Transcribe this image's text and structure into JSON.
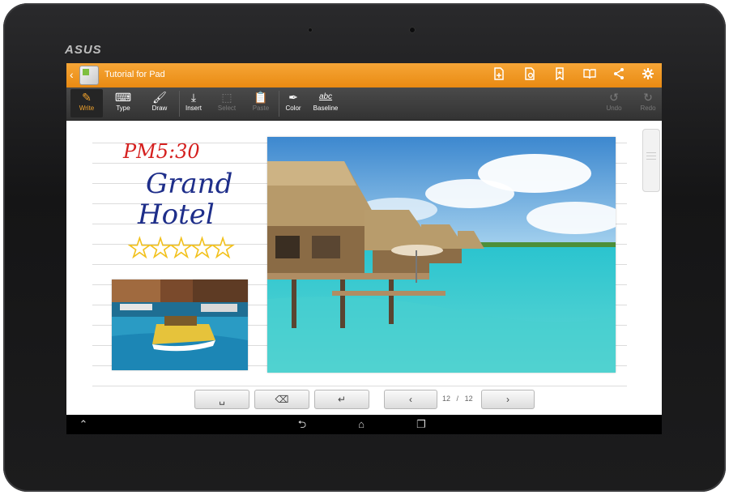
{
  "device": {
    "brand": "ASUS"
  },
  "app": {
    "title": "Tutorial for Pad",
    "action_icons": [
      "new-page-icon",
      "page-settings-icon",
      "bookmark-icon",
      "book-icon",
      "share-icon",
      "settings-gear-icon"
    ]
  },
  "toolbar": {
    "write": "Write",
    "type": "Type",
    "draw": "Draw",
    "insert": "Insert",
    "select": "Select",
    "paste": "Paste",
    "color": "Color",
    "baseline": "Baseline",
    "baseline_glyph": "abc",
    "undo": "Undo",
    "redo": "Redo"
  },
  "note": {
    "handwriting_time": "PM5:30",
    "handwriting_title_line1": "Grand",
    "handwriting_title_line2": "Hotel",
    "stars": "★★★★★"
  },
  "pager": {
    "current": "12",
    "separator": "/",
    "total": "12"
  },
  "colors": {
    "accent": "#f0a22c",
    "ink_red": "#d5201f",
    "ink_blue": "#1e2e8a",
    "star_yellow": "#f2c11c"
  }
}
